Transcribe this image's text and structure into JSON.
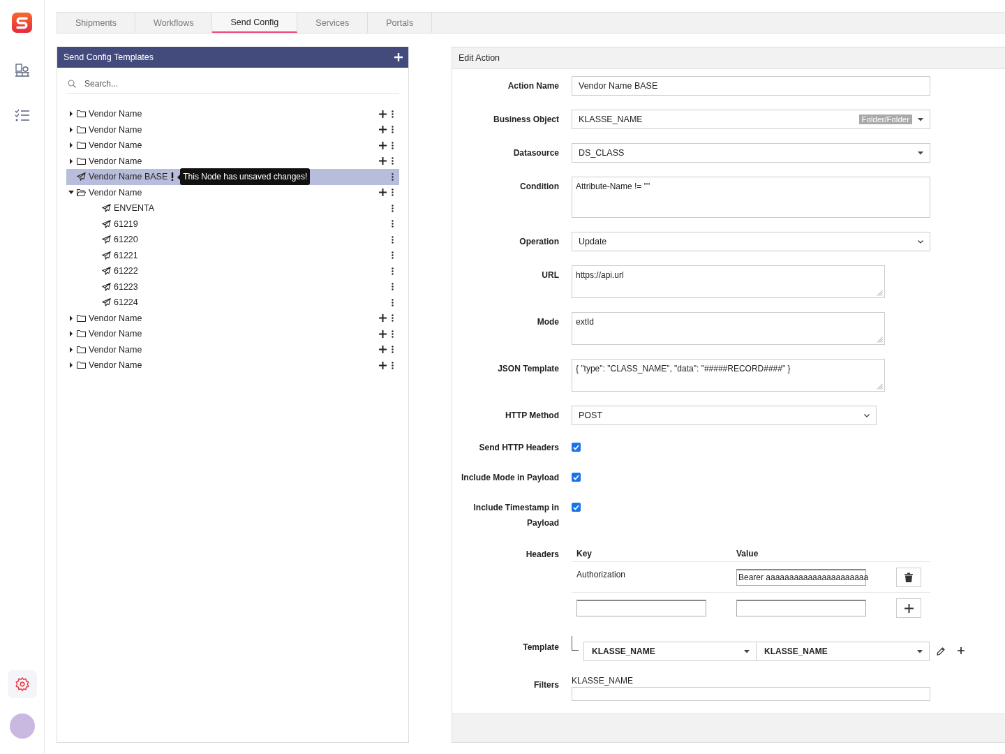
{
  "sidebar": {
    "nav_top": [
      {
        "kind": "pallet",
        "selected": false
      },
      {
        "kind": "checklist",
        "selected": false
      }
    ],
    "nav_bottom": [
      {
        "kind": "settings",
        "selected": true
      }
    ]
  },
  "tabs": [
    {
      "label": "Shipments",
      "selected": false
    },
    {
      "label": "Workflows",
      "selected": false
    },
    {
      "label": "Send Config",
      "selected": true
    },
    {
      "label": "Services",
      "selected": false
    },
    {
      "label": "Portals",
      "selected": false
    }
  ],
  "templates": {
    "title": "Send Config Templates",
    "search": {
      "placeholder": "Search..."
    },
    "items": [
      {
        "label": "Vendor Name",
        "kind": "folder",
        "expanded": false,
        "selected": false
      },
      {
        "label": "Vendor Name",
        "kind": "folder",
        "expanded": false,
        "selected": false
      },
      {
        "label": "Vendor Name",
        "kind": "folder",
        "expanded": false,
        "selected": false
      },
      {
        "label": "Vendor Name",
        "kind": "folder",
        "expanded": false,
        "selected": false
      },
      {
        "label": "Vendor Name BASE",
        "kind": "action",
        "selected": true,
        "unsaved": true,
        "tooltip": "This Node has unsaved changes!"
      },
      {
        "label": "Vendor Name",
        "kind": "folder",
        "expanded": true,
        "selected": false,
        "children": [
          {
            "label": "ENVENTA",
            "kind": "action",
            "selected": false
          },
          {
            "label": "61219",
            "kind": "action",
            "selected": false
          },
          {
            "label": "61220",
            "kind": "action",
            "selected": false
          },
          {
            "label": "61221",
            "kind": "action",
            "selected": false
          },
          {
            "label": "61222",
            "kind": "action",
            "selected": false
          },
          {
            "label": "61223",
            "kind": "action",
            "selected": false
          },
          {
            "label": "61224",
            "kind": "action",
            "selected": false
          }
        ]
      },
      {
        "label": "Vendor Name",
        "kind": "folder",
        "expanded": false,
        "selected": false
      },
      {
        "label": "Vendor Name",
        "kind": "folder",
        "expanded": false,
        "selected": false
      },
      {
        "label": "Vendor Name",
        "kind": "folder",
        "expanded": false,
        "selected": false
      },
      {
        "label": "Vendor Name",
        "kind": "folder",
        "expanded": false,
        "selected": false
      }
    ]
  },
  "edit_action": {
    "title": "Edit Action",
    "fields": [
      {
        "kind": "text",
        "label": "Action Name",
        "value": "Vendor Name BASE"
      },
      {
        "kind": "select",
        "label": "Business Object",
        "value": "KLASSE_NAME",
        "tag": "Folder/Folder"
      },
      {
        "kind": "select",
        "label": "Datasource",
        "value": "DS_CLASS"
      },
      {
        "kind": "textarea",
        "label": "Condition",
        "value": "Attribute-Name != \"\"",
        "resizable": false
      },
      {
        "kind": "dropdown",
        "label": "Operation",
        "value": "Update"
      },
      {
        "kind": "textarea",
        "label": "URL",
        "value": "https://api.url",
        "resizable": true
      },
      {
        "kind": "textarea",
        "label": "Mode",
        "value": "extId",
        "resizable": true
      },
      {
        "kind": "textarea",
        "label": "JSON Template",
        "value": "{ \"type\": \"CLASS_NAME\", \"data\": \"#####RECORD####\" }",
        "resizable": true
      },
      {
        "kind": "dropdown",
        "label": "HTTP Method",
        "value": "POST"
      },
      {
        "kind": "checkbox",
        "label": "Send HTTP Headers",
        "checked": true
      },
      {
        "kind": "checkbox",
        "label": "Include Mode in Payload",
        "checked": true
      },
      {
        "kind": "checkbox",
        "label": "Include Timestamp in Payload",
        "checked": true
      },
      {
        "kind": "headers",
        "label": "Headers",
        "columns": [
          "Key",
          "Value"
        ],
        "rows": [
          {
            "key": "Authorization",
            "value": "Bearer aaaaaaaaaaaaaaaaaaaaaa"
          }
        ]
      },
      {
        "kind": "template",
        "label": "Template",
        "values": [
          "KLASSE_NAME",
          "KLASSE_NAME"
        ]
      },
      {
        "kind": "filters",
        "label": "Filters",
        "value": "KLASSE_NAME"
      }
    ]
  }
}
